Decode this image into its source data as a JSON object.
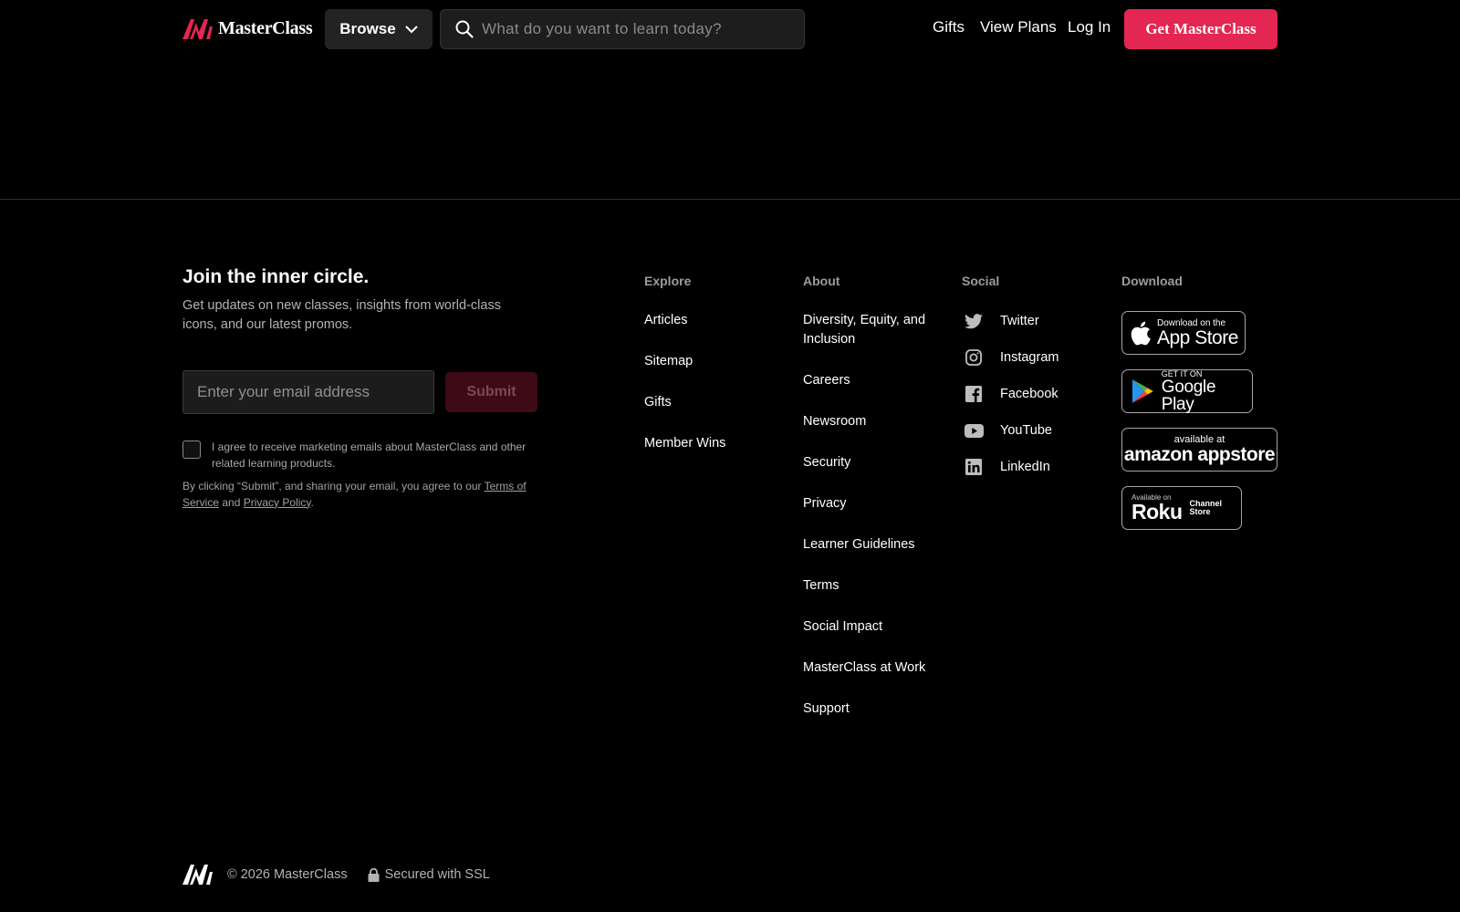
{
  "header": {
    "logo_text": "MasterClass",
    "browse_label": "Browse",
    "search_placeholder": "What do you want to learn today?",
    "nav": [
      "Gifts",
      "View Plans",
      "Log In"
    ],
    "cta_label": "Get MasterClass",
    "brand_color": "#e32652"
  },
  "newsletter": {
    "title": "Join the inner circle.",
    "description": "Get updates on new classes, insights from world-class icons, and our latest promos.",
    "email_placeholder": "Enter your email address",
    "submit_label": "Submit",
    "agree_text": "I agree to receive marketing emails about MasterClass and other related learning products.",
    "legal_prefix": "By clicking “Submit”, and sharing your email, you agree to our ",
    "terms_link": "Terms of Service",
    "legal_and": " and ",
    "privacy_link": "Privacy Policy",
    "legal_suffix": "."
  },
  "explore": {
    "heading": "Explore",
    "links": [
      "Articles",
      "Sitemap",
      "Gifts",
      "Member Wins"
    ]
  },
  "about": {
    "heading": "About",
    "links": [
      "Diversity, Equity, and Inclusion",
      "Careers",
      "Newsroom",
      "Security",
      "Privacy",
      "Learner Guidelines",
      "Terms",
      "Social Impact",
      "MasterClass at Work",
      "Support"
    ]
  },
  "social": {
    "heading": "Social",
    "items": [
      {
        "label": "Twitter",
        "icon": "twitter-icon"
      },
      {
        "label": "Instagram",
        "icon": "instagram-icon"
      },
      {
        "label": "Facebook",
        "icon": "facebook-icon"
      },
      {
        "label": "YouTube",
        "icon": "youtube-icon"
      },
      {
        "label": "LinkedIn",
        "icon": "linkedin-icon"
      }
    ]
  },
  "download": {
    "heading": "Download",
    "appstore": {
      "small": "Download on the",
      "big": "App Store"
    },
    "googleplay": {
      "small": "GET IT ON",
      "big": "Google Play"
    },
    "amazon": {
      "small": "available at",
      "big": "amazon appstore"
    },
    "roku": {
      "small": "Available on",
      "big": "Roku",
      "side": "Channel Store"
    }
  },
  "footer": {
    "copyright": "© 2026 MasterClass",
    "ssl": "Secured with SSL"
  }
}
